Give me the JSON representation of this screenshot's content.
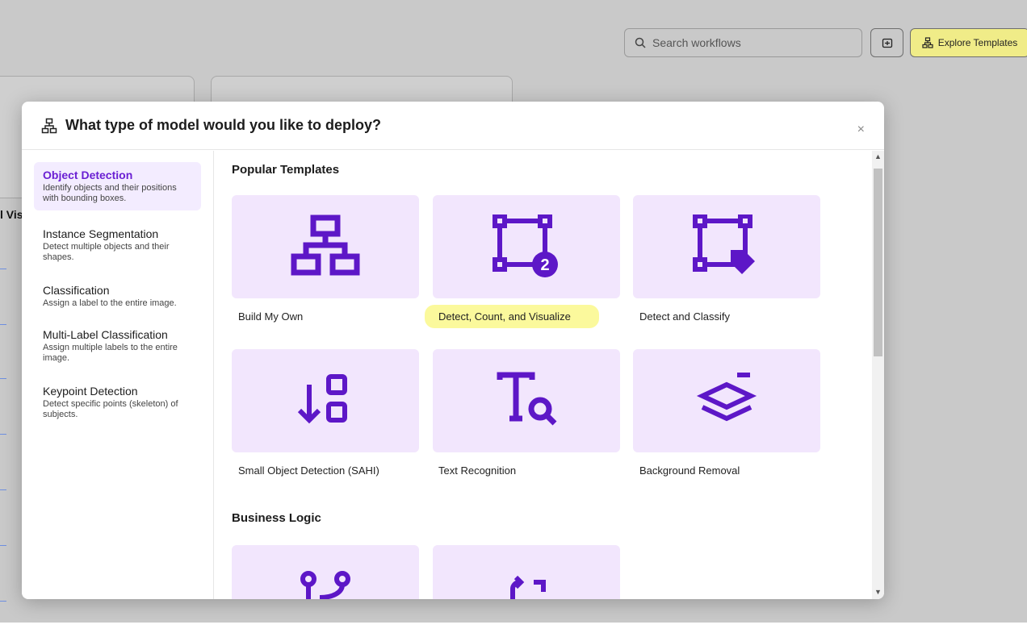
{
  "background": {
    "search_placeholder": "Search workflows",
    "explore_label": "Explore Templates",
    "edge_text": "l Vis"
  },
  "modal": {
    "title": "What type of model would you like to deploy?",
    "close": "×"
  },
  "sidebar": {
    "items": [
      {
        "title": "Object Detection",
        "desc": "Identify objects and their positions with bounding boxes.",
        "active": true
      },
      {
        "title": "Instance Segmentation",
        "desc": "Detect multiple objects and their shapes."
      },
      {
        "title": "Classification",
        "desc": "Assign a label to the entire image."
      },
      {
        "title": "Multi-Label Classification",
        "desc": "Assign multiple labels to the entire image."
      },
      {
        "title": "Keypoint Detection",
        "desc": "Detect specific points (skeleton) of subjects."
      }
    ]
  },
  "sections": {
    "popular": "Popular Templates",
    "business": "Business Logic"
  },
  "templates": [
    {
      "label": "Build My Own",
      "icon": "network-icon"
    },
    {
      "label": "Detect, Count, and Visualize",
      "icon": "bounding-box-count-icon"
    },
    {
      "label": "Detect and Classify",
      "icon": "bounding-box-tag-icon"
    },
    {
      "label": "Small Object Detection (SAHI)",
      "icon": "arrow-down-squares-icon"
    },
    {
      "label": "Text Recognition",
      "icon": "text-search-icon"
    },
    {
      "label": "Background Removal",
      "icon": "layers-minus-icon"
    }
  ],
  "colors": {
    "accent": "#6a1fd3",
    "tile": "#f2e6fd",
    "highlight": "#fbf99c"
  }
}
